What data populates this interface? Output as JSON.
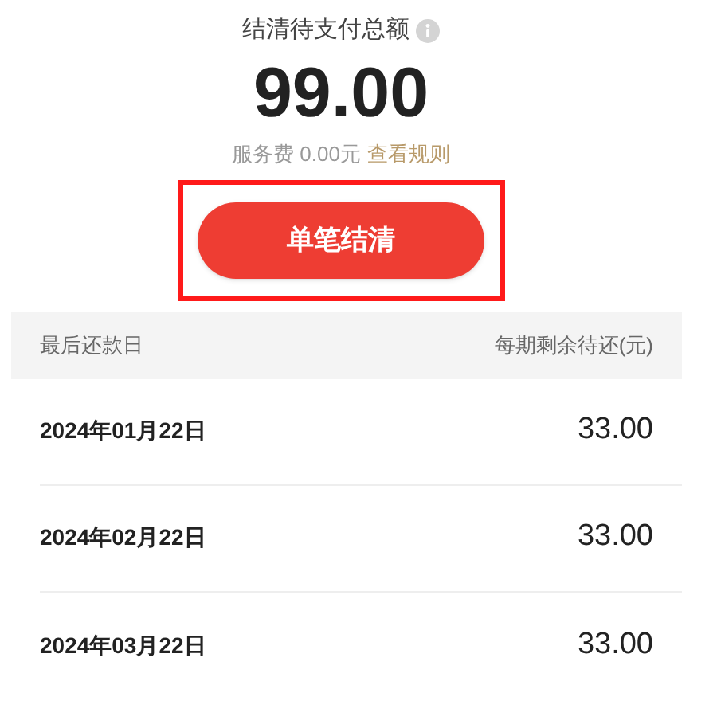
{
  "summary": {
    "title": "结清待支付总额",
    "amount": "99.00",
    "fee_label": "服务费 0.00元",
    "rules_link": "查看规则"
  },
  "settle_button": "单笔结清",
  "table": {
    "columns": [
      "最后还款日",
      "每期剩余待还(元)"
    ],
    "rows": [
      {
        "date": "2024年01月22日",
        "amount": "33.00"
      },
      {
        "date": "2024年02月22日",
        "amount": "33.00"
      },
      {
        "date": "2024年03月22日",
        "amount": "33.00"
      }
    ]
  }
}
